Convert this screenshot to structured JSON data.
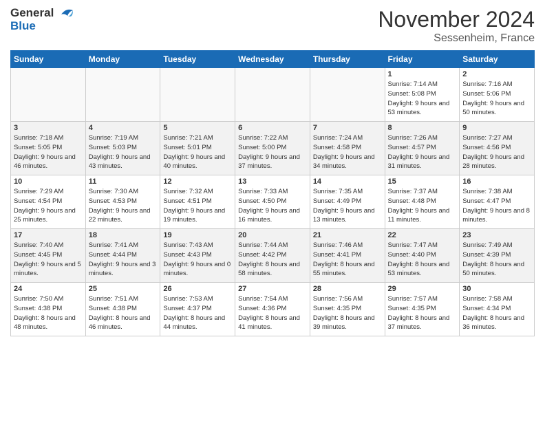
{
  "header": {
    "logo_line1": "General",
    "logo_line2": "Blue",
    "month_title": "November 2024",
    "location": "Sessenheim, France"
  },
  "days_of_week": [
    "Sunday",
    "Monday",
    "Tuesday",
    "Wednesday",
    "Thursday",
    "Friday",
    "Saturday"
  ],
  "weeks": [
    [
      {
        "day": "",
        "empty": true
      },
      {
        "day": "",
        "empty": true
      },
      {
        "day": "",
        "empty": true
      },
      {
        "day": "",
        "empty": true
      },
      {
        "day": "",
        "empty": true
      },
      {
        "day": "1",
        "sunrise": "Sunrise: 7:14 AM",
        "sunset": "Sunset: 5:08 PM",
        "daylight": "Daylight: 9 hours and 53 minutes."
      },
      {
        "day": "2",
        "sunrise": "Sunrise: 7:16 AM",
        "sunset": "Sunset: 5:06 PM",
        "daylight": "Daylight: 9 hours and 50 minutes."
      }
    ],
    [
      {
        "day": "3",
        "sunrise": "Sunrise: 7:18 AM",
        "sunset": "Sunset: 5:05 PM",
        "daylight": "Daylight: 9 hours and 46 minutes."
      },
      {
        "day": "4",
        "sunrise": "Sunrise: 7:19 AM",
        "sunset": "Sunset: 5:03 PM",
        "daylight": "Daylight: 9 hours and 43 minutes."
      },
      {
        "day": "5",
        "sunrise": "Sunrise: 7:21 AM",
        "sunset": "Sunset: 5:01 PM",
        "daylight": "Daylight: 9 hours and 40 minutes."
      },
      {
        "day": "6",
        "sunrise": "Sunrise: 7:22 AM",
        "sunset": "Sunset: 5:00 PM",
        "daylight": "Daylight: 9 hours and 37 minutes."
      },
      {
        "day": "7",
        "sunrise": "Sunrise: 7:24 AM",
        "sunset": "Sunset: 4:58 PM",
        "daylight": "Daylight: 9 hours and 34 minutes."
      },
      {
        "day": "8",
        "sunrise": "Sunrise: 7:26 AM",
        "sunset": "Sunset: 4:57 PM",
        "daylight": "Daylight: 9 hours and 31 minutes."
      },
      {
        "day": "9",
        "sunrise": "Sunrise: 7:27 AM",
        "sunset": "Sunset: 4:56 PM",
        "daylight": "Daylight: 9 hours and 28 minutes."
      }
    ],
    [
      {
        "day": "10",
        "sunrise": "Sunrise: 7:29 AM",
        "sunset": "Sunset: 4:54 PM",
        "daylight": "Daylight: 9 hours and 25 minutes."
      },
      {
        "day": "11",
        "sunrise": "Sunrise: 7:30 AM",
        "sunset": "Sunset: 4:53 PM",
        "daylight": "Daylight: 9 hours and 22 minutes."
      },
      {
        "day": "12",
        "sunrise": "Sunrise: 7:32 AM",
        "sunset": "Sunset: 4:51 PM",
        "daylight": "Daylight: 9 hours and 19 minutes."
      },
      {
        "day": "13",
        "sunrise": "Sunrise: 7:33 AM",
        "sunset": "Sunset: 4:50 PM",
        "daylight": "Daylight: 9 hours and 16 minutes."
      },
      {
        "day": "14",
        "sunrise": "Sunrise: 7:35 AM",
        "sunset": "Sunset: 4:49 PM",
        "daylight": "Daylight: 9 hours and 13 minutes."
      },
      {
        "day": "15",
        "sunrise": "Sunrise: 7:37 AM",
        "sunset": "Sunset: 4:48 PM",
        "daylight": "Daylight: 9 hours and 11 minutes."
      },
      {
        "day": "16",
        "sunrise": "Sunrise: 7:38 AM",
        "sunset": "Sunset: 4:47 PM",
        "daylight": "Daylight: 9 hours and 8 minutes."
      }
    ],
    [
      {
        "day": "17",
        "sunrise": "Sunrise: 7:40 AM",
        "sunset": "Sunset: 4:45 PM",
        "daylight": "Daylight: 9 hours and 5 minutes."
      },
      {
        "day": "18",
        "sunrise": "Sunrise: 7:41 AM",
        "sunset": "Sunset: 4:44 PM",
        "daylight": "Daylight: 9 hours and 3 minutes."
      },
      {
        "day": "19",
        "sunrise": "Sunrise: 7:43 AM",
        "sunset": "Sunset: 4:43 PM",
        "daylight": "Daylight: 9 hours and 0 minutes."
      },
      {
        "day": "20",
        "sunrise": "Sunrise: 7:44 AM",
        "sunset": "Sunset: 4:42 PM",
        "daylight": "Daylight: 8 hours and 58 minutes."
      },
      {
        "day": "21",
        "sunrise": "Sunrise: 7:46 AM",
        "sunset": "Sunset: 4:41 PM",
        "daylight": "Daylight: 8 hours and 55 minutes."
      },
      {
        "day": "22",
        "sunrise": "Sunrise: 7:47 AM",
        "sunset": "Sunset: 4:40 PM",
        "daylight": "Daylight: 8 hours and 53 minutes."
      },
      {
        "day": "23",
        "sunrise": "Sunrise: 7:49 AM",
        "sunset": "Sunset: 4:39 PM",
        "daylight": "Daylight: 8 hours and 50 minutes."
      }
    ],
    [
      {
        "day": "24",
        "sunrise": "Sunrise: 7:50 AM",
        "sunset": "Sunset: 4:38 PM",
        "daylight": "Daylight: 8 hours and 48 minutes."
      },
      {
        "day": "25",
        "sunrise": "Sunrise: 7:51 AM",
        "sunset": "Sunset: 4:38 PM",
        "daylight": "Daylight: 8 hours and 46 minutes."
      },
      {
        "day": "26",
        "sunrise": "Sunrise: 7:53 AM",
        "sunset": "Sunset: 4:37 PM",
        "daylight": "Daylight: 8 hours and 44 minutes."
      },
      {
        "day": "27",
        "sunrise": "Sunrise: 7:54 AM",
        "sunset": "Sunset: 4:36 PM",
        "daylight": "Daylight: 8 hours and 41 minutes."
      },
      {
        "day": "28",
        "sunrise": "Sunrise: 7:56 AM",
        "sunset": "Sunset: 4:35 PM",
        "daylight": "Daylight: 8 hours and 39 minutes."
      },
      {
        "day": "29",
        "sunrise": "Sunrise: 7:57 AM",
        "sunset": "Sunset: 4:35 PM",
        "daylight": "Daylight: 8 hours and 37 minutes."
      },
      {
        "day": "30",
        "sunrise": "Sunrise: 7:58 AM",
        "sunset": "Sunset: 4:34 PM",
        "daylight": "Daylight: 8 hours and 36 minutes."
      }
    ]
  ]
}
